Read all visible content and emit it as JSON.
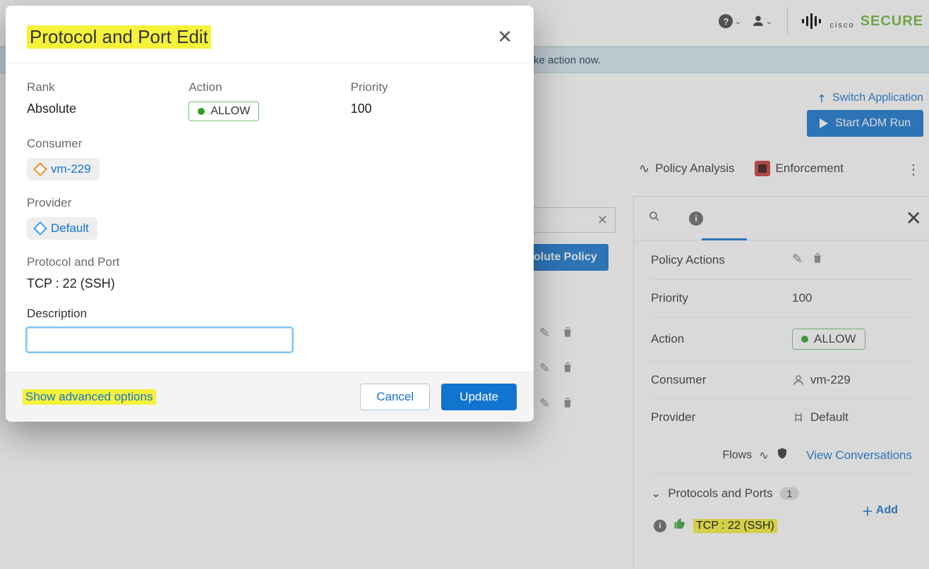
{
  "topbar": {
    "brand_word": "SECURE",
    "brand_prefix": "cisco"
  },
  "banner": {
    "text_fragment": "ke action now."
  },
  "page_actions": {
    "switch_app": "Switch Application",
    "run_adm": "Start ADM Run"
  },
  "tabs": {
    "analysis": "Policy Analysis",
    "enforcement": "Enforcement"
  },
  "bg": {
    "abs_chip": "olute Policy"
  },
  "detail": {
    "policy_actions_label": "Policy Actions",
    "priority_label": "Priority",
    "priority_value": "100",
    "action_label": "Action",
    "action_value": "ALLOW",
    "consumer_label": "Consumer",
    "consumer_value": "vm-229",
    "provider_label": "Provider",
    "provider_value": "Default",
    "flows_label": "Flows",
    "view_conversations": "View Conversations",
    "pp_label": "Protocols and Ports",
    "pp_count": "1",
    "pp_add": "Add",
    "pp_item": "TCP : 22 (SSH)"
  },
  "modal": {
    "title": "Protocol and Port Edit",
    "rank_label": "Rank",
    "rank_value": "Absolute",
    "action_label": "Action",
    "action_value": "ALLOW",
    "priority_label": "Priority",
    "priority_value": "100",
    "consumer_label": "Consumer",
    "consumer_value": "vm-229",
    "provider_label": "Provider",
    "provider_value": "Default",
    "pp_label": "Protocol and Port",
    "pp_value": "TCP : 22 (SSH)",
    "desc_label": "Description",
    "desc_value": "",
    "adv_link": "Show advanced options",
    "cancel": "Cancel",
    "update": "Update"
  }
}
